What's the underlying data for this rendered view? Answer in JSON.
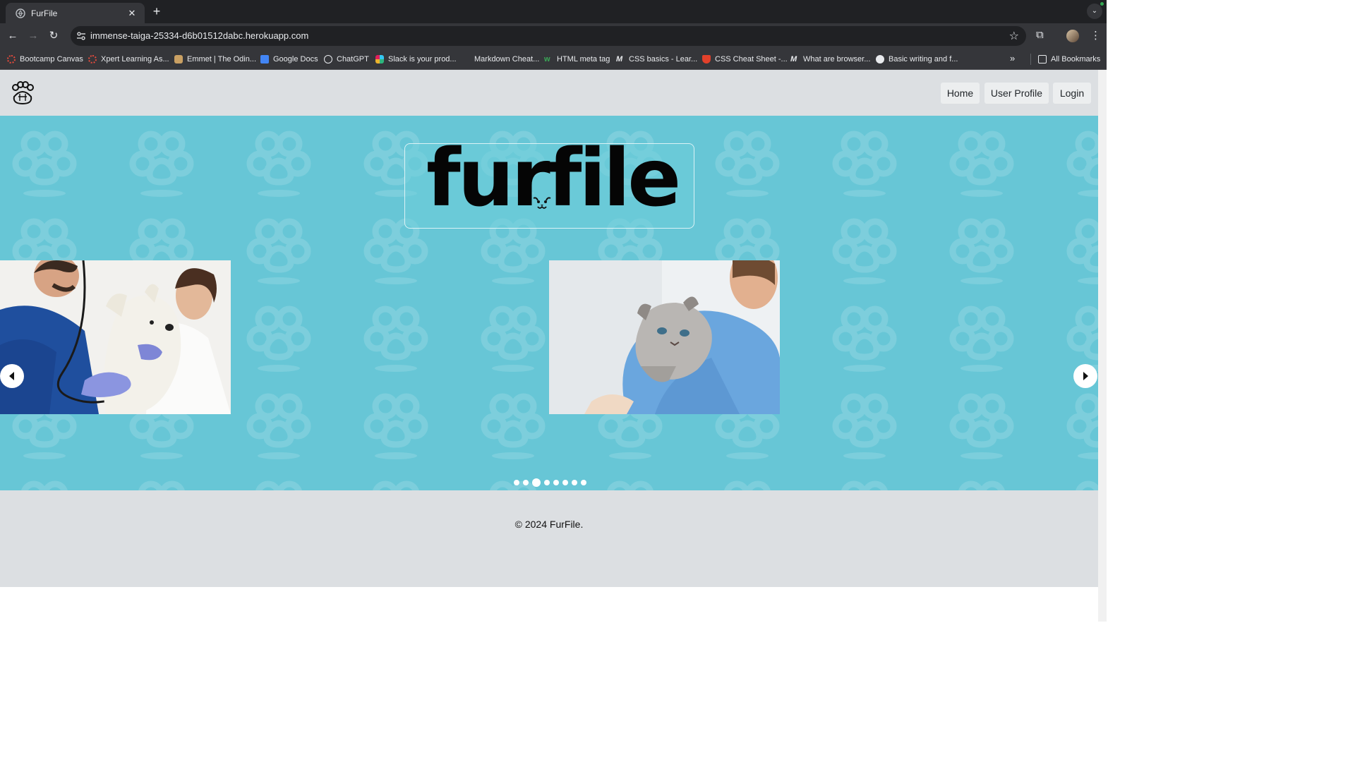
{
  "browser": {
    "tab_title": "FurFile",
    "url": "immense-taiga-25334-d6b01512dabc.herokuapp.com",
    "bookmarks": [
      {
        "label": "Bootcamp Canvas",
        "icon": "canvas-icon"
      },
      {
        "label": "Xpert Learning As...",
        "icon": "xpert-icon"
      },
      {
        "label": "Emmet | The Odin...",
        "icon": "odin-icon"
      },
      {
        "label": "Google Docs",
        "icon": "docs-icon"
      },
      {
        "label": "ChatGPT",
        "icon": "chatgpt-icon"
      },
      {
        "label": "Slack is your prod...",
        "icon": "slack-icon"
      },
      {
        "label": "Markdown Cheat...",
        "icon": "markdown-icon"
      },
      {
        "label": "HTML meta tag",
        "icon": "w-icon"
      },
      {
        "label": "CSS basics - Lear...",
        "icon": "mdn-icon"
      },
      {
        "label": "CSS Cheat Sheet -...",
        "icon": "css-icon"
      },
      {
        "label": "What are browser...",
        "icon": "mdn-icon"
      },
      {
        "label": "Basic writing and f...",
        "icon": "github-icon"
      }
    ],
    "all_bookmarks_label": "All Bookmarks"
  },
  "nav": {
    "home": "Home",
    "profile": "User Profile",
    "login": "Login"
  },
  "hero": {
    "brand": "furfile",
    "slides": [
      {
        "name": "vet-with-dog-photo"
      },
      {
        "name": "vet-with-cat-photo"
      }
    ],
    "dot_count": 8,
    "active_dot": 2
  },
  "footer": {
    "copyright": "© 2024 FurFile."
  },
  "colors": {
    "hero_bg": "#67c6d6",
    "header_bg": "#dcdfe2",
    "chrome_dark": "#202124",
    "chrome_mid": "#35363a"
  }
}
